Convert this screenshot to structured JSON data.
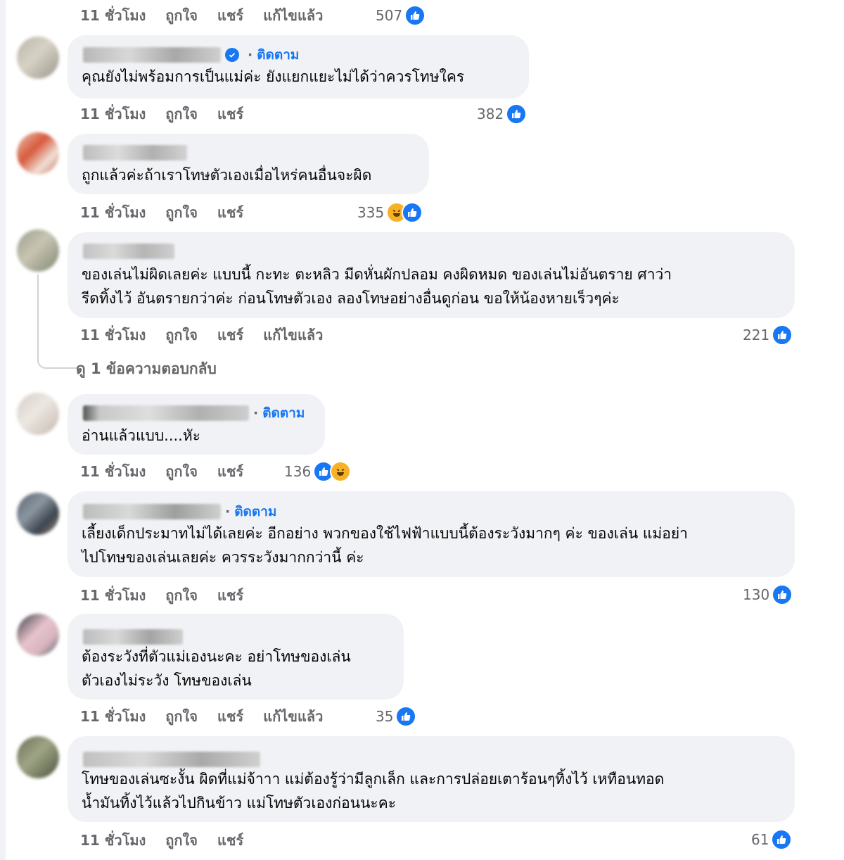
{
  "labels": {
    "like": "ถูกใจ",
    "share": "แชร์",
    "edited": "แก้ไขแล้ว",
    "follow": "ติดตาม",
    "dot": "·"
  },
  "top_actions": {
    "time": "11 ชั่วโมง",
    "reactions": "507"
  },
  "comments": [
    {
      "verified": true,
      "follow": true,
      "lines": [
        "คุณยังไม่พร้อมการเป็นแม่ค่ะ ยังแยกแยะไม่ได้ว่าควรโทษใคร"
      ],
      "time": "11 ชั่วโมง",
      "edited": false,
      "reactions": "382",
      "reaction_icons": [
        "like-icon"
      ]
    },
    {
      "verified": false,
      "follow": false,
      "lines": [
        "ถูกแล้วค่ะถ้าเราโทษตัวเองเมื่อไหร่คนอื่นจะผิด"
      ],
      "time": "11 ชั่วโมง",
      "edited": false,
      "reactions": "335",
      "reaction_icons": [
        "haha-icon",
        "like-icon"
      ]
    },
    {
      "verified": false,
      "follow": false,
      "lines": [
        "ของเล่นไม่ผิดเลยค่ะ แบบนี้ กะทะ ตะหลิว มีดหั่นผักปลอม คงผิดหมด ของเล่นไม่อันตราย ศาว่า",
        "รีดทิ้งไว้ อันตรายกว่าค่ะ ก่อนโทษตัวเอง ลองโทษอย่างอื่นดูก่อน ขอให้น้องหายเร็วๆค่ะ"
      ],
      "time": "11 ชั่วโมง",
      "edited": true,
      "reactions": "221",
      "reaction_icons": [
        "like-icon"
      ],
      "replies": "ดู 1 ข้อความตอบกลับ"
    },
    {
      "verified": false,
      "follow": true,
      "lines": [
        "อ่านแล้วแบบ....หัะ"
      ],
      "time": "11 ชั่วโมง",
      "edited": false,
      "reactions": "136",
      "reaction_icons": [
        "like-icon",
        "haha-icon"
      ]
    },
    {
      "verified": false,
      "follow": true,
      "lines": [
        "เลี้ยงเด็กประมาทไม่ได้เลยค่ะ อีกอย่าง พวกของใช้ไฟฟ้าแบบนี้ต้องระวังมากๆ ค่ะ ของเล่น แม่อย่า",
        "ไปโทษของเล่นเลยค่ะ ควรระวังมากกว่านี้ ค่ะ"
      ],
      "time": "11 ชั่วโมง",
      "edited": false,
      "reactions": "130",
      "reaction_icons": [
        "like-icon"
      ]
    },
    {
      "verified": false,
      "follow": false,
      "lines": [
        "ต้องระวังที่ตัวแม่เองนะคะ อย่าโทษของเล่น",
        "ตัวเองไม่ระวัง โทษของเล่น"
      ],
      "time": "11 ชั่วโมง",
      "edited": true,
      "reactions": "35",
      "reaction_icons": [
        "like-icon"
      ]
    },
    {
      "verified": false,
      "follow": false,
      "lines": [
        "โทษของเล่นซะงั้น ผิดที่แม่จ้าาา แม่ต้องรู้ว่ามีลูกเล็ก และการปล่อยเตาร้อนๆทิ้งไว้ เหทือนทอด",
        "น้ำมันทิ้งไว้แล้วไปกินข้าว แม่โทษตัวเองก่อนนะคะ"
      ],
      "time": "11 ชั่วโมง",
      "edited": false,
      "reactions": "61",
      "reaction_icons": [
        "like-icon"
      ]
    }
  ],
  "colors": {
    "accent": "#1877f2",
    "bubble": "#f0f2f5",
    "muted": "#65676b",
    "haha": "#f7b125"
  }
}
